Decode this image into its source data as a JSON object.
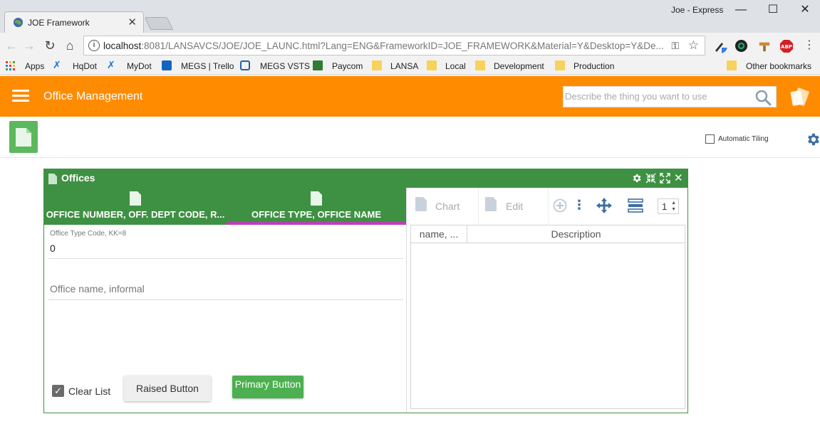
{
  "browser": {
    "tab_title": "JOE Framework",
    "window_user": "Joe - Express",
    "url_host": "localhost",
    "url_rest": ":8081/LANSAVCS/JOE/JOE_LAUNC.html?Lang=ENG&FrameworkID=JOE_FRAMEWORK&Material=Y&Desktop=Y&De...",
    "bookmarks": [
      "Apps",
      "HqDot",
      "MyDot",
      "MEGS | Trello",
      "MEGS VSTS",
      "Paycom",
      "LANSA",
      "Local",
      "Development",
      "Production"
    ],
    "other_bookmarks": "Other bookmarks"
  },
  "app": {
    "title": "Office Management",
    "search_placeholder": "Describe the thing you want to use",
    "automatic_tiling_label": "Automatic Tiling",
    "brand_color": "#ff8c00",
    "accent_green": "#3e9142"
  },
  "panel": {
    "title": "Offices",
    "tabs": [
      {
        "label": "OFFICE NUMBER, OFF. DEPT CODE, R..."
      },
      {
        "label": "OFFICE TYPE, OFFICE NAME",
        "selected": true
      }
    ],
    "form": {
      "type_code_label": "Office Type Code, KK=8",
      "type_code_value": "0",
      "name_placeholder": "Office name, informal",
      "clear_list_label": "Clear List",
      "clear_list_checked": true,
      "raised_button": "Raised Button",
      "primary_button": "Primary Button"
    },
    "toolbar": {
      "chart_label": "Chart",
      "edit_label": "Edit",
      "page_value": "1"
    },
    "grid": {
      "columns": [
        "name, ...",
        "Description"
      ]
    }
  }
}
